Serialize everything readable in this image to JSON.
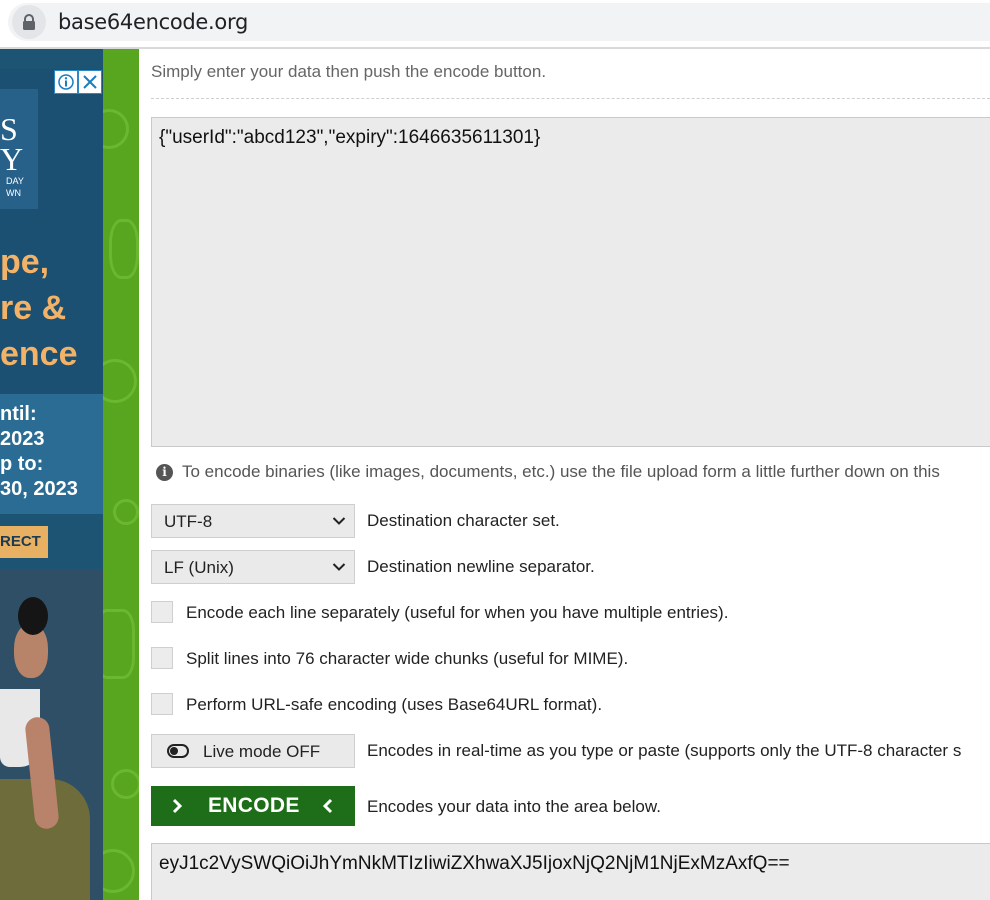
{
  "browser": {
    "url": "base64encode.org"
  },
  "ad": {
    "card_big": "YS\nY",
    "card_small": "DAY\nWN",
    "headline": [
      "pe,",
      "re &",
      "ence"
    ],
    "dates": [
      "ntil:",
      "2023",
      "p to:",
      "30, 2023"
    ],
    "cta": "RECT",
    "colors": {
      "background": "#1d5474",
      "headline": "#f2b268",
      "cta": "#e8b062"
    }
  },
  "main": {
    "intro": "Simply enter your data then push the encode button.",
    "input_value": "{\"userId\":\"abcd123\",\"expiry\":1646635611301}",
    "info_text": "To encode binaries (like images, documents, etc.) use the file upload form a little further down on this",
    "charset": {
      "value": "UTF-8",
      "label": "Destination character set."
    },
    "newline": {
      "value": "LF (Unix)",
      "label": "Destination newline separator."
    },
    "options": [
      {
        "label": "Encode each line separately (useful for when you have multiple entries).",
        "checked": false
      },
      {
        "label": "Split lines into 76 character wide chunks (useful for MIME).",
        "checked": false
      },
      {
        "label": "Perform URL-safe encoding (uses Base64URL format).",
        "checked": false
      }
    ],
    "live_mode": {
      "label": "Live mode OFF",
      "description": "Encodes in real-time as you type or paste (supports only the UTF-8 character s"
    },
    "encode": {
      "label": "ENCODE",
      "description": "Encodes your data into the area below."
    },
    "output_value": "eyJ1c2VySWQiOiJhYmNkMTIzIiwiZXhwaXJ5IjoxNjQ2NjM1NjExMzAxfQ==",
    "colors": {
      "accent_green": "#1e6e19",
      "border_green": "#58a61f"
    }
  }
}
